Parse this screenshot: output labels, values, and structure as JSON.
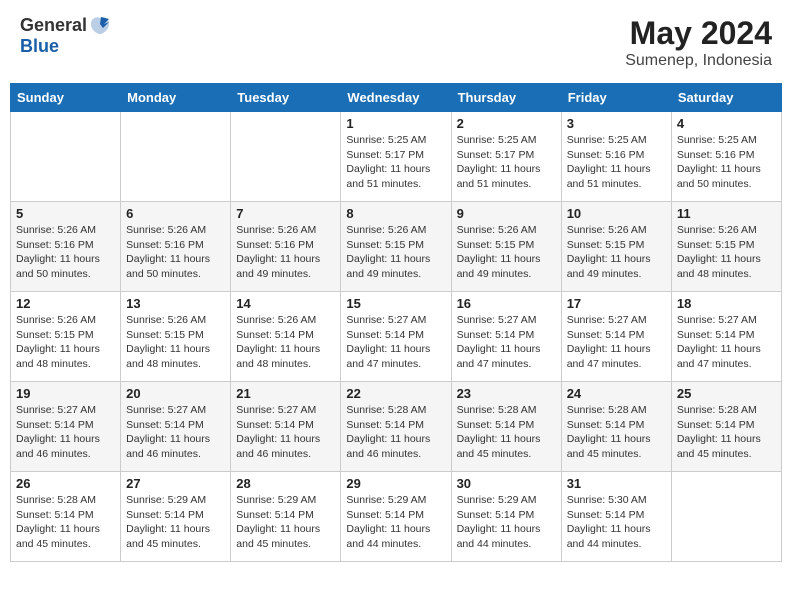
{
  "header": {
    "logo_general": "General",
    "logo_blue": "Blue",
    "month_year": "May 2024",
    "location": "Sumenep, Indonesia"
  },
  "weekdays": [
    "Sunday",
    "Monday",
    "Tuesday",
    "Wednesday",
    "Thursday",
    "Friday",
    "Saturday"
  ],
  "weeks": [
    [
      {
        "day": "",
        "sunrise": "",
        "sunset": "",
        "daylight": ""
      },
      {
        "day": "",
        "sunrise": "",
        "sunset": "",
        "daylight": ""
      },
      {
        "day": "",
        "sunrise": "",
        "sunset": "",
        "daylight": ""
      },
      {
        "day": "1",
        "sunrise": "Sunrise: 5:25 AM",
        "sunset": "Sunset: 5:17 PM",
        "daylight": "Daylight: 11 hours and 51 minutes."
      },
      {
        "day": "2",
        "sunrise": "Sunrise: 5:25 AM",
        "sunset": "Sunset: 5:17 PM",
        "daylight": "Daylight: 11 hours and 51 minutes."
      },
      {
        "day": "3",
        "sunrise": "Sunrise: 5:25 AM",
        "sunset": "Sunset: 5:16 PM",
        "daylight": "Daylight: 11 hours and 51 minutes."
      },
      {
        "day": "4",
        "sunrise": "Sunrise: 5:25 AM",
        "sunset": "Sunset: 5:16 PM",
        "daylight": "Daylight: 11 hours and 50 minutes."
      }
    ],
    [
      {
        "day": "5",
        "sunrise": "Sunrise: 5:26 AM",
        "sunset": "Sunset: 5:16 PM",
        "daylight": "Daylight: 11 hours and 50 minutes."
      },
      {
        "day": "6",
        "sunrise": "Sunrise: 5:26 AM",
        "sunset": "Sunset: 5:16 PM",
        "daylight": "Daylight: 11 hours and 50 minutes."
      },
      {
        "day": "7",
        "sunrise": "Sunrise: 5:26 AM",
        "sunset": "Sunset: 5:16 PM",
        "daylight": "Daylight: 11 hours and 49 minutes."
      },
      {
        "day": "8",
        "sunrise": "Sunrise: 5:26 AM",
        "sunset": "Sunset: 5:15 PM",
        "daylight": "Daylight: 11 hours and 49 minutes."
      },
      {
        "day": "9",
        "sunrise": "Sunrise: 5:26 AM",
        "sunset": "Sunset: 5:15 PM",
        "daylight": "Daylight: 11 hours and 49 minutes."
      },
      {
        "day": "10",
        "sunrise": "Sunrise: 5:26 AM",
        "sunset": "Sunset: 5:15 PM",
        "daylight": "Daylight: 11 hours and 49 minutes."
      },
      {
        "day": "11",
        "sunrise": "Sunrise: 5:26 AM",
        "sunset": "Sunset: 5:15 PM",
        "daylight": "Daylight: 11 hours and 48 minutes."
      }
    ],
    [
      {
        "day": "12",
        "sunrise": "Sunrise: 5:26 AM",
        "sunset": "Sunset: 5:15 PM",
        "daylight": "Daylight: 11 hours and 48 minutes."
      },
      {
        "day": "13",
        "sunrise": "Sunrise: 5:26 AM",
        "sunset": "Sunset: 5:15 PM",
        "daylight": "Daylight: 11 hours and 48 minutes."
      },
      {
        "day": "14",
        "sunrise": "Sunrise: 5:26 AM",
        "sunset": "Sunset: 5:14 PM",
        "daylight": "Daylight: 11 hours and 48 minutes."
      },
      {
        "day": "15",
        "sunrise": "Sunrise: 5:27 AM",
        "sunset": "Sunset: 5:14 PM",
        "daylight": "Daylight: 11 hours and 47 minutes."
      },
      {
        "day": "16",
        "sunrise": "Sunrise: 5:27 AM",
        "sunset": "Sunset: 5:14 PM",
        "daylight": "Daylight: 11 hours and 47 minutes."
      },
      {
        "day": "17",
        "sunrise": "Sunrise: 5:27 AM",
        "sunset": "Sunset: 5:14 PM",
        "daylight": "Daylight: 11 hours and 47 minutes."
      },
      {
        "day": "18",
        "sunrise": "Sunrise: 5:27 AM",
        "sunset": "Sunset: 5:14 PM",
        "daylight": "Daylight: 11 hours and 47 minutes."
      }
    ],
    [
      {
        "day": "19",
        "sunrise": "Sunrise: 5:27 AM",
        "sunset": "Sunset: 5:14 PM",
        "daylight": "Daylight: 11 hours and 46 minutes."
      },
      {
        "day": "20",
        "sunrise": "Sunrise: 5:27 AM",
        "sunset": "Sunset: 5:14 PM",
        "daylight": "Daylight: 11 hours and 46 minutes."
      },
      {
        "day": "21",
        "sunrise": "Sunrise: 5:27 AM",
        "sunset": "Sunset: 5:14 PM",
        "daylight": "Daylight: 11 hours and 46 minutes."
      },
      {
        "day": "22",
        "sunrise": "Sunrise: 5:28 AM",
        "sunset": "Sunset: 5:14 PM",
        "daylight": "Daylight: 11 hours and 46 minutes."
      },
      {
        "day": "23",
        "sunrise": "Sunrise: 5:28 AM",
        "sunset": "Sunset: 5:14 PM",
        "daylight": "Daylight: 11 hours and 45 minutes."
      },
      {
        "day": "24",
        "sunrise": "Sunrise: 5:28 AM",
        "sunset": "Sunset: 5:14 PM",
        "daylight": "Daylight: 11 hours and 45 minutes."
      },
      {
        "day": "25",
        "sunrise": "Sunrise: 5:28 AM",
        "sunset": "Sunset: 5:14 PM",
        "daylight": "Daylight: 11 hours and 45 minutes."
      }
    ],
    [
      {
        "day": "26",
        "sunrise": "Sunrise: 5:28 AM",
        "sunset": "Sunset: 5:14 PM",
        "daylight": "Daylight: 11 hours and 45 minutes."
      },
      {
        "day": "27",
        "sunrise": "Sunrise: 5:29 AM",
        "sunset": "Sunset: 5:14 PM",
        "daylight": "Daylight: 11 hours and 45 minutes."
      },
      {
        "day": "28",
        "sunrise": "Sunrise: 5:29 AM",
        "sunset": "Sunset: 5:14 PM",
        "daylight": "Daylight: 11 hours and 45 minutes."
      },
      {
        "day": "29",
        "sunrise": "Sunrise: 5:29 AM",
        "sunset": "Sunset: 5:14 PM",
        "daylight": "Daylight: 11 hours and 44 minutes."
      },
      {
        "day": "30",
        "sunrise": "Sunrise: 5:29 AM",
        "sunset": "Sunset: 5:14 PM",
        "daylight": "Daylight: 11 hours and 44 minutes."
      },
      {
        "day": "31",
        "sunrise": "Sunrise: 5:30 AM",
        "sunset": "Sunset: 5:14 PM",
        "daylight": "Daylight: 11 hours and 44 minutes."
      },
      {
        "day": "",
        "sunrise": "",
        "sunset": "",
        "daylight": ""
      }
    ]
  ]
}
